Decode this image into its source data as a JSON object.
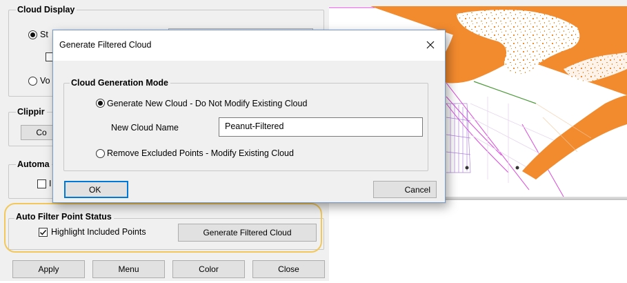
{
  "left": {
    "cloud_display": {
      "title": "Cloud Display",
      "radio1_label_visible": "St",
      "radio2_label_visible": "Vo"
    },
    "clipping": {
      "title_visible": "Clippir",
      "button_visible": "Co"
    },
    "automatic": {
      "title_visible": "Automa",
      "check_label_visible": "I"
    },
    "auto_filter": {
      "title": "Auto Filter Point Status",
      "highlight_label": "Highlight Included Points",
      "highlight_checked": true,
      "generate_button": "Generate Filtered Cloud"
    },
    "bottom_buttons": {
      "apply": "Apply",
      "menu": "Menu",
      "color": "Color",
      "close": "Close"
    }
  },
  "dialog": {
    "title": "Generate Filtered Cloud",
    "close_glyph": "✕",
    "group_title": "Cloud Generation Mode",
    "option_new": "Generate New Cloud - Do Not Modify Existing Cloud",
    "option_new_selected": true,
    "name_label": "New Cloud Name",
    "name_value": "Peanut-Filtered",
    "option_remove": "Remove Excluded Points - Modify Existing Cloud",
    "ok": "OK",
    "cancel": "Cancel"
  },
  "colors": {
    "point_cloud": "#f28a2e",
    "highlight_ring": "#f3c85a",
    "accent_border": "#0078d7",
    "guide_lines": "#d94ad9"
  }
}
